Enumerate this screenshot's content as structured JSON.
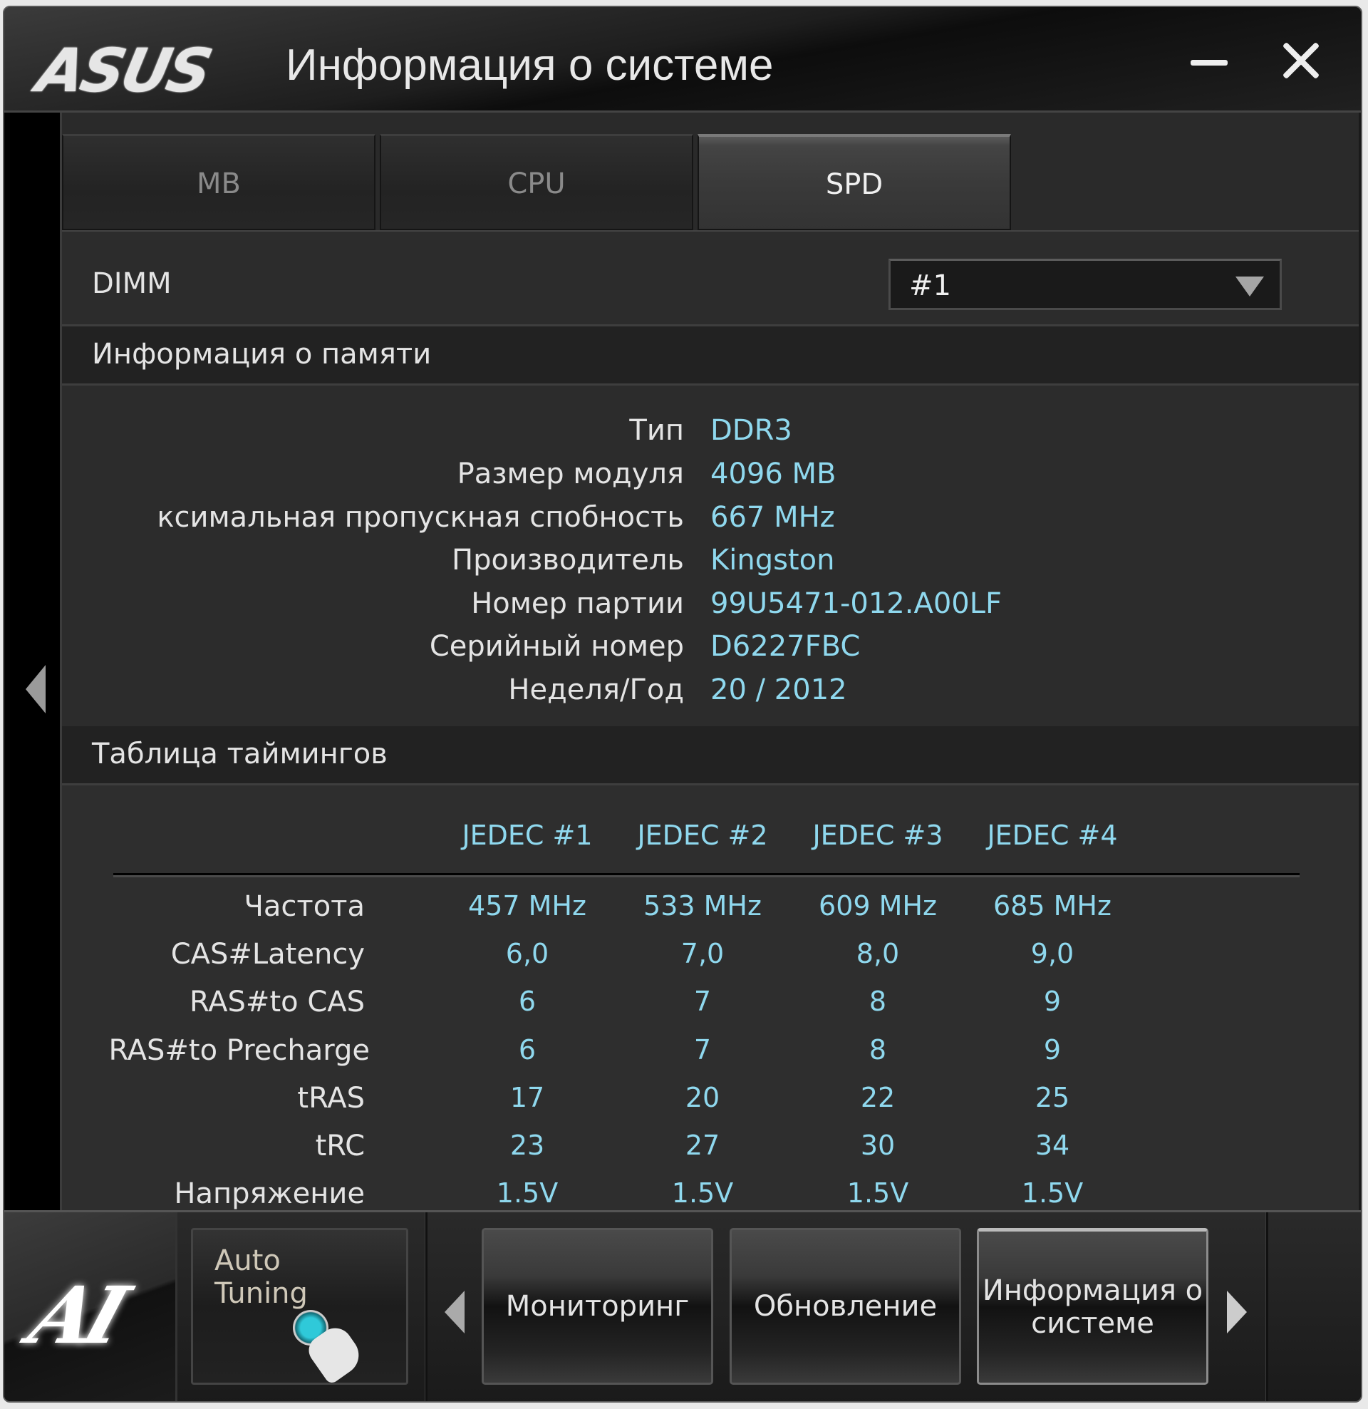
{
  "window": {
    "brand": "ASUS",
    "title": "Информация о системе",
    "minimize_icon": "minimize-icon",
    "close_icon": "close-icon"
  },
  "tabs": [
    {
      "label": "MB",
      "active": false
    },
    {
      "label": "CPU",
      "active": false
    },
    {
      "label": "SPD",
      "active": true
    }
  ],
  "dimm": {
    "label": "DIMM",
    "selected": "#1"
  },
  "memory_info": {
    "header": "Информация о памяти",
    "rows": [
      {
        "label": "Тип",
        "value": "DDR3"
      },
      {
        "label": "Размер модуля",
        "value": "4096 MB"
      },
      {
        "label": "ксимальная пропускная спобность",
        "value": "667 MHz"
      },
      {
        "label": "Производитель",
        "value": "Kingston"
      },
      {
        "label": "Номер партии",
        "value": "99U5471-012.A00LF"
      },
      {
        "label": "Серийный номер",
        "value": "D6227FBC"
      },
      {
        "label": "Неделя/Год",
        "value": "20 / 2012"
      }
    ]
  },
  "timings": {
    "header": "Таблица таймингов",
    "columns": [
      "JEDEC #1",
      "JEDEC #2",
      "JEDEC #3",
      "JEDEC #4"
    ],
    "rows": [
      {
        "label": "Частота",
        "values": [
          "457 MHz",
          "533 MHz",
          "609 MHz",
          "685 MHz"
        ]
      },
      {
        "label": "CAS#Latency",
        "values": [
          "6,0",
          "7,0",
          "8,0",
          "9,0"
        ]
      },
      {
        "label": "RAS#to CAS",
        "values": [
          "6",
          "7",
          "8",
          "9"
        ]
      },
      {
        "label": "RAS#to Precharge",
        "values": [
          "6",
          "7",
          "8",
          "9"
        ]
      },
      {
        "label": "tRAS",
        "values": [
          "17",
          "20",
          "22",
          "25"
        ]
      },
      {
        "label": "tRC",
        "values": [
          "23",
          "27",
          "30",
          "34"
        ]
      },
      {
        "label": "Напряжение",
        "values": [
          "1.5V",
          "1.5V",
          "1.5V",
          "1.5V"
        ]
      }
    ]
  },
  "bottom_bar": {
    "logo": "AI",
    "auto_tuning_label": "Auto Tuning",
    "nav_buttons": [
      {
        "label": "Мониторинг",
        "active": false
      },
      {
        "label": "Обновление",
        "active": false
      },
      {
        "label": "Информация о системе",
        "active": true
      }
    ]
  },
  "colors": {
    "value_text": "#8fd8ee",
    "label_text": "#e4e4e4",
    "background": "#2c2c2c"
  }
}
